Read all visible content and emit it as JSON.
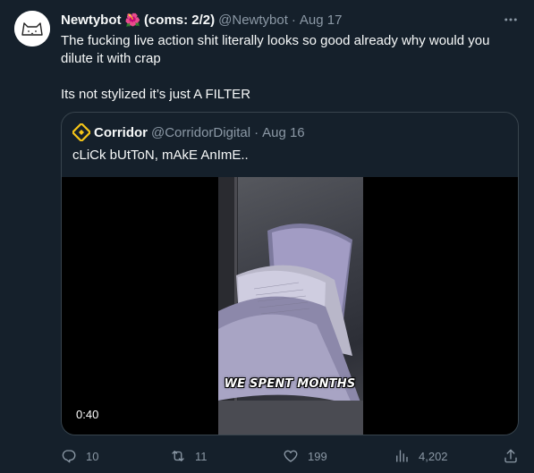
{
  "tweet": {
    "author": {
      "display_name": "Newtybot",
      "name_suffix": "(coms: 2/2)",
      "name_emoji": "🌺",
      "handle": "@Newtybot",
      "separator": "·",
      "date": "Aug 17"
    },
    "text_line_1": "The fucking live action shit literally looks so good already why would you dilute it with crap",
    "text_line_2": "Its not stylized it’s just A FILTER",
    "more_icon": "more-horizontal-icon"
  },
  "quote": {
    "author": {
      "display_name": "Corridor",
      "handle": "@CorridorDigital",
      "separator": "·",
      "date": "Aug 16",
      "logo_color": "#f5c518"
    },
    "text": "cLiCk bUtToN, mAkE AnImE..",
    "video": {
      "caption": "WE SPENT MONTHS",
      "duration": "0:40"
    }
  },
  "actions": {
    "reply": {
      "icon": "reply-icon",
      "count": "10"
    },
    "retweet": {
      "icon": "retweet-icon",
      "count": "11"
    },
    "like": {
      "icon": "heart-icon",
      "count": "199"
    },
    "views": {
      "icon": "views-icon",
      "count": "4,202"
    },
    "share": {
      "icon": "share-icon"
    }
  },
  "colors": {
    "background": "#15202b",
    "text": "#f7f9f9",
    "muted": "#8b98a5",
    "border": "#38444d"
  }
}
